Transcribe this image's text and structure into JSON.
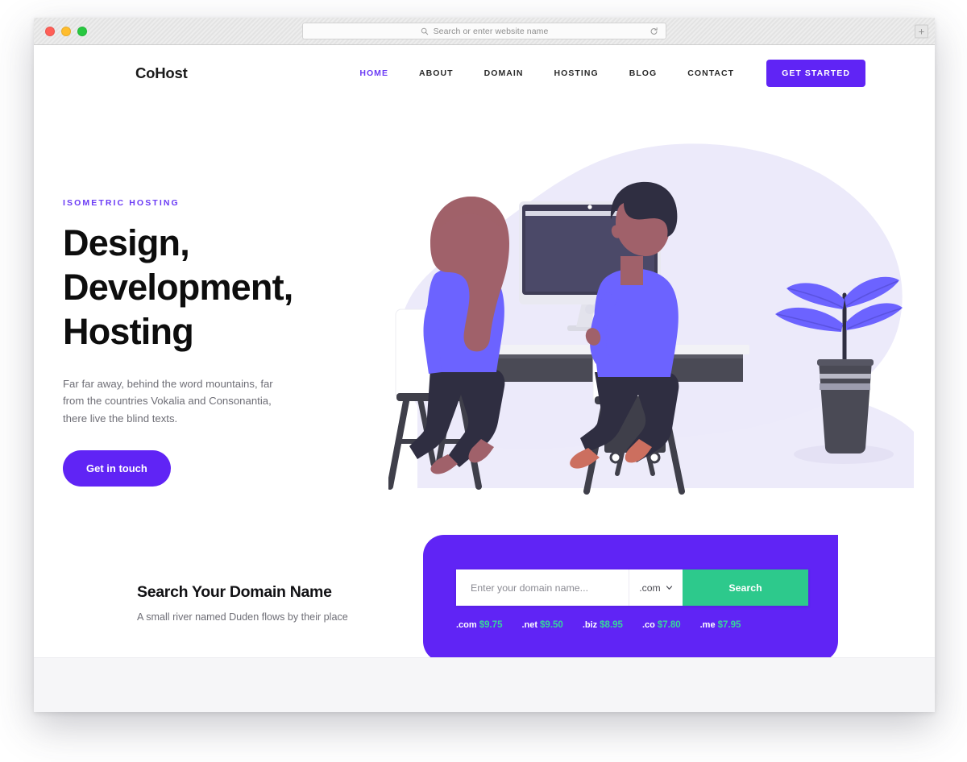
{
  "browser": {
    "traffic_lights": [
      "close",
      "minimize",
      "zoom"
    ],
    "address_placeholder": "Search or enter website name",
    "reload_icon": "reload-icon",
    "search_icon": "search-icon",
    "new_tab_label": "+"
  },
  "nav": {
    "logo": "CoHost",
    "links": [
      {
        "label": "HOME",
        "active": true
      },
      {
        "label": "ABOUT",
        "active": false
      },
      {
        "label": "DOMAIN",
        "active": false
      },
      {
        "label": "HOSTING",
        "active": false
      },
      {
        "label": "BLOG",
        "active": false
      },
      {
        "label": "CONTACT",
        "active": false
      }
    ],
    "cta": "GET STARTED"
  },
  "hero": {
    "eyebrow": "ISOMETRIC HOSTING",
    "title_line1": "Design,",
    "title_line2": "Development,",
    "title_line3": "Hosting",
    "paragraph": "Far far away, behind the word mountains, far from the countries Vokalia and Consonantia, there live the blind texts.",
    "cta": "Get in touch",
    "illustration_name": "two-people-at-desk-with-imac-illustration"
  },
  "domain": {
    "heading": "Search Your Domain Name",
    "subheading": "A small river named Duden flows by their place",
    "input_placeholder": "Enter your domain name...",
    "input_value": "",
    "tld_selected": ".com",
    "tld_options": [
      ".com",
      ".net",
      ".biz",
      ".co",
      ".me"
    ],
    "search_button": "Search",
    "prices": [
      {
        "tld": ".com",
        "price": "$9.75"
      },
      {
        "tld": ".net",
        "price": "$9.50"
      },
      {
        "tld": ".biz",
        "price": "$8.95"
      },
      {
        "tld": ".co",
        "price": "$7.80"
      },
      {
        "tld": ".me",
        "price": "$7.95"
      }
    ]
  },
  "colors": {
    "brand_purple": "#6024f5",
    "link_purple": "#6b3bf5",
    "accent_green": "#2dc98c",
    "price_green": "#37d69b",
    "blob_lavender": "#eceafa",
    "illustration_blue": "#6c63ff",
    "dark_slate": "#3f3d56",
    "skin_tone": "#a0616a",
    "footer_gray": "#f6f6f8"
  }
}
